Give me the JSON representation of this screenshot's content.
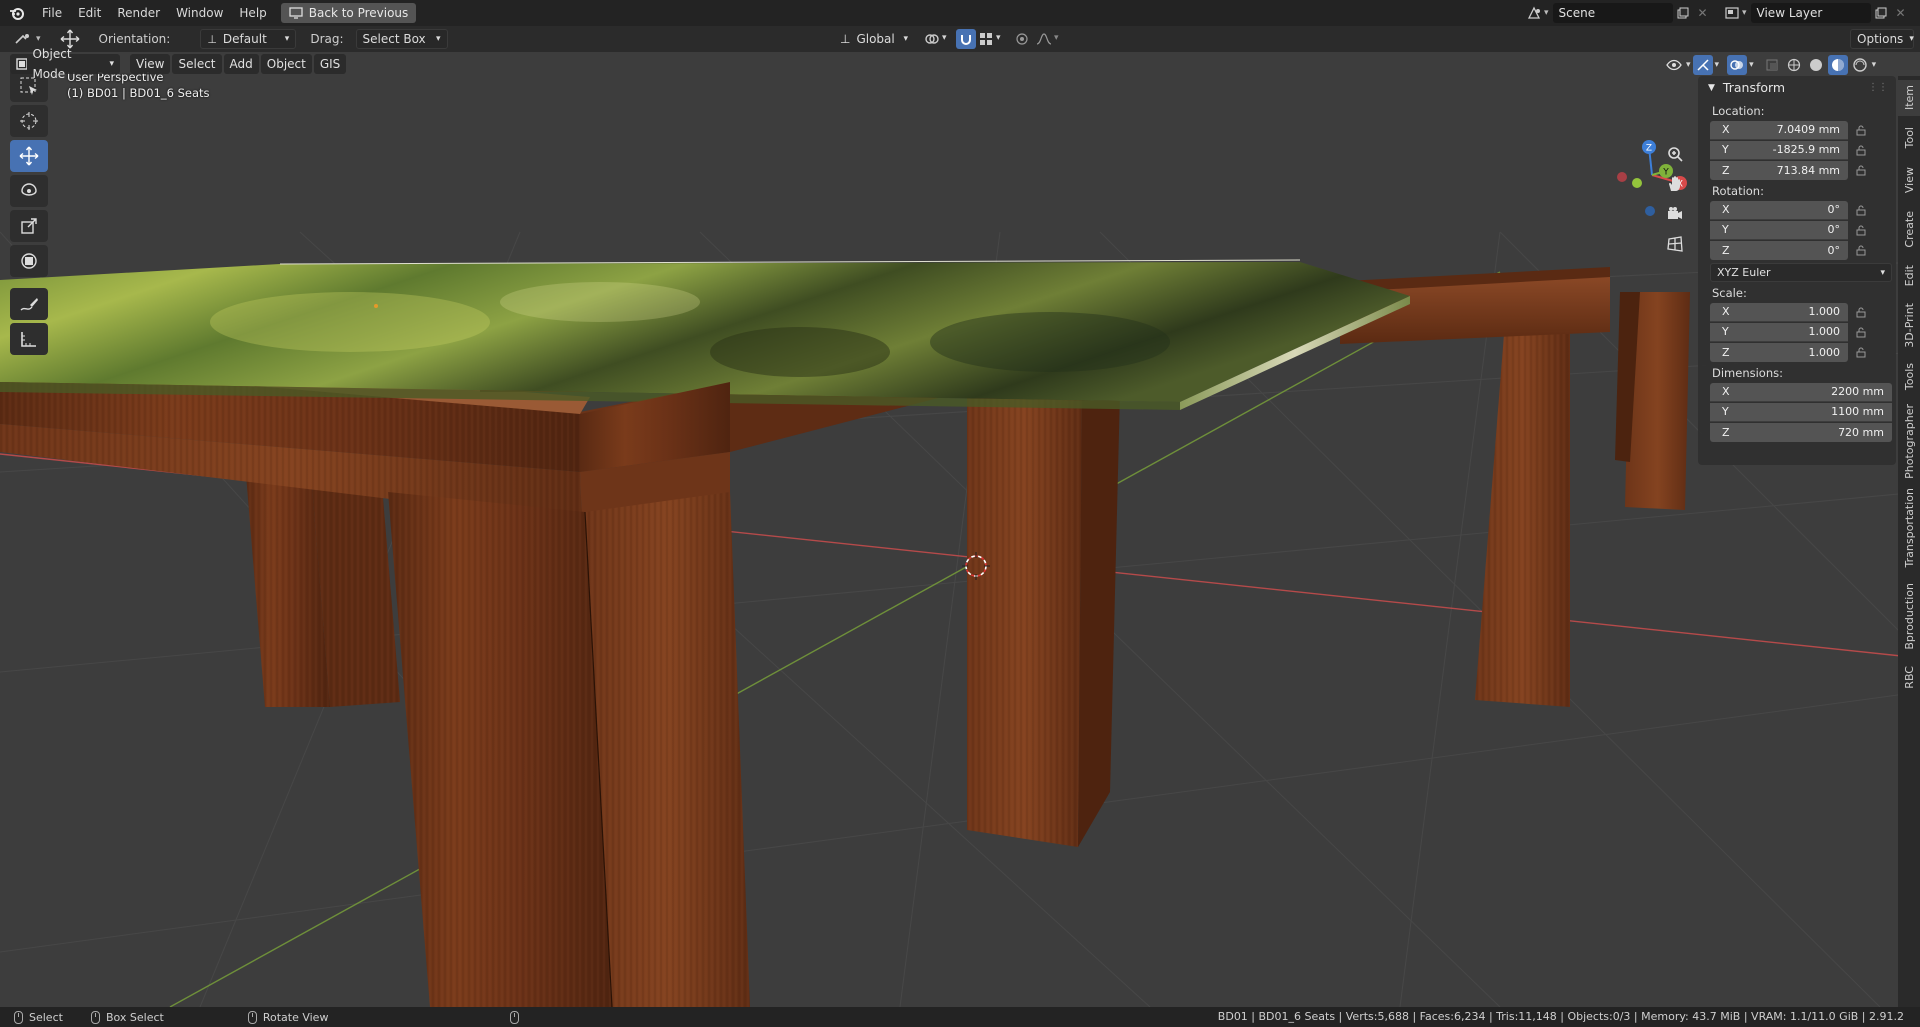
{
  "menubar": {
    "items": [
      "File",
      "Edit",
      "Render",
      "Window",
      "Help"
    ],
    "back_button": "Back to Previous",
    "scene": "Scene",
    "view_layer": "View Layer"
  },
  "toolsettings": {
    "orientation_label": "Orientation:",
    "orientation_value": "Default",
    "drag_label": "Drag:",
    "drag_value": "Select Box",
    "transform_orientation": "Global",
    "options": "Options"
  },
  "viewport_header": {
    "mode": "Object Mode",
    "menus": [
      "View",
      "Select",
      "Add",
      "Object",
      "GIS"
    ]
  },
  "viewport": {
    "perspective": "User Perspective",
    "active_object": "(1) BD01 | BD01_6 Seats"
  },
  "transform_panel": {
    "title": "Transform",
    "location_label": "Location:",
    "location": [
      {
        "axis": "X",
        "value": "7.0409 mm"
      },
      {
        "axis": "Y",
        "value": "-1825.9 mm"
      },
      {
        "axis": "Z",
        "value": "713.84 mm"
      }
    ],
    "rotation_label": "Rotation:",
    "rotation": [
      {
        "axis": "X",
        "value": "0°"
      },
      {
        "axis": "Y",
        "value": "0°"
      },
      {
        "axis": "Z",
        "value": "0°"
      }
    ],
    "rotation_mode": "XYZ Euler",
    "scale_label": "Scale:",
    "scale": [
      {
        "axis": "X",
        "value": "1.000"
      },
      {
        "axis": "Y",
        "value": "1.000"
      },
      {
        "axis": "Z",
        "value": "1.000"
      }
    ],
    "dimensions_label": "Dimensions:",
    "dimensions": [
      {
        "axis": "X",
        "value": "2200 mm"
      },
      {
        "axis": "Y",
        "value": "1100 mm"
      },
      {
        "axis": "Z",
        "value": "720 mm"
      }
    ]
  },
  "sidebar_tabs": [
    "Item",
    "Tool",
    "View",
    "Create",
    "Edit",
    "3D-Print",
    "Tools",
    "Photographer",
    "Transportation",
    "Bproduction",
    "RBC"
  ],
  "gizmo": {
    "x": "X",
    "y": "Y",
    "z": "Z"
  },
  "statusbar": {
    "select": "Select",
    "box_select": "Box Select",
    "rotate_view": "Rotate View",
    "stats": "BD01 | BD01_6 Seats | Verts:5,688 | Faces:6,234 | Tris:11,148 | Objects:0/3 | Memory: 43.7 MiB | VRAM: 1.1/11.0 GiB | 2.91.2"
  },
  "colors": {
    "accent": "#4772b3",
    "wood": "#6e3519",
    "axis_x": "#d94a4a",
    "axis_y": "#7fb23a",
    "axis_z": "#3d7fd9"
  }
}
